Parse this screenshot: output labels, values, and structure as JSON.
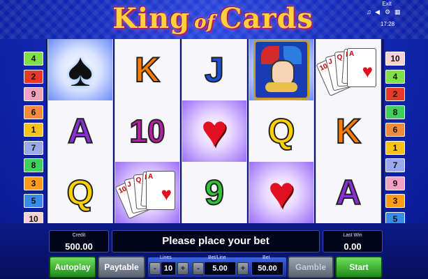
{
  "game_title": {
    "part1": "King",
    "part2": "of",
    "part3": "Cards"
  },
  "system": {
    "exit_label": "Exit",
    "time": "17:28"
  },
  "left_lines": [
    "4",
    "2",
    "9",
    "6",
    "1",
    "7",
    "8",
    "3",
    "5",
    "10"
  ],
  "right_lines": [
    "10",
    "4",
    "2",
    "8",
    "6",
    "1",
    "7",
    "9",
    "3",
    "5"
  ],
  "reels": [
    [
      "spade",
      "A",
      "Q"
    ],
    [
      "K",
      "10",
      "hand"
    ],
    [
      "J",
      "heart",
      "9"
    ],
    [
      "joker",
      "Q",
      "heart"
    ],
    [
      "hand",
      "K",
      "A"
    ]
  ],
  "credit": {
    "label": "Credit",
    "value": "500.00"
  },
  "message": "Please place your bet",
  "last_win": {
    "label": "Last Win",
    "value": "0.00"
  },
  "buttons": {
    "autoplay": "Autoplay",
    "paytable": "Paytable",
    "gamble": "Gamble",
    "start": "Start"
  },
  "lines": {
    "label": "Lines",
    "value": "10",
    "minus": "-",
    "plus": "+"
  },
  "bet_line": {
    "label": "Bet/Line",
    "value": "5.00",
    "minus": "-",
    "plus": "+"
  },
  "bet": {
    "label": "Bet",
    "value": "50.00"
  },
  "colors": {
    "K": "#ff7a00",
    "10": "#b51fa8",
    "J": "#1f4ed6",
    "Q": "#ffd000",
    "A": "#8a2fd6",
    "9": "#31c23a",
    "line_colors": [
      "#f7c21a",
      "#e53a2a",
      "#ff9a1a",
      "#7fe04a",
      "#3a8ae8",
      "#f28a3a",
      "#9aa9e8",
      "#3fcf5a",
      "#f0a0c0",
      "#f4d2d2"
    ]
  },
  "icons": {
    "spade": "spade-icon",
    "heart": "heart-icon",
    "joker": "joker-icon",
    "hand": "card-hand-icon",
    "music": "music-icon",
    "volume": "volume-icon",
    "settings": "settings-icon"
  }
}
